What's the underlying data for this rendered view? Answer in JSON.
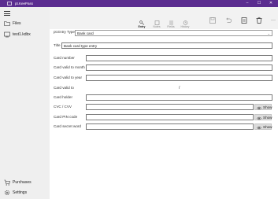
{
  "window": {
    "title": "pt.KeePass",
    "minimize": "–",
    "maximize": "☐",
    "close": "✕"
  },
  "sidebar": {
    "items": [
      {
        "label": "Files",
        "icon": "folder-icon"
      },
      {
        "label": "test1.kdbx",
        "icon": "database-icon"
      }
    ],
    "bottom": [
      {
        "label": "Purchases",
        "icon": "cart-icon"
      },
      {
        "label": "Settings",
        "icon": "gear-icon"
      }
    ]
  },
  "tabs": [
    {
      "label": "Entry",
      "active": true
    },
    {
      "label": "Notes",
      "active": false
    },
    {
      "label": "Fields",
      "active": false
    },
    {
      "label": "History",
      "active": false
    }
  ],
  "commands": {
    "more": "···"
  },
  "form": {
    "entry_type_label": "pt.Entry Type",
    "entry_type_value": "Bank card",
    "title_label": "Title",
    "title_value": "Bank card type entry",
    "card_number_label": "Card number",
    "valid_month_label": "Card valid to month",
    "valid_year_label": "Card valid to year",
    "valid_to_label": "Card valid to",
    "valid_to_separator": "/",
    "holder_label": "Card holder",
    "cvc_label": "CVC / CVV",
    "pin_label": "Card PIN code",
    "secret_label": "Card secret word",
    "show_label": "Show"
  }
}
